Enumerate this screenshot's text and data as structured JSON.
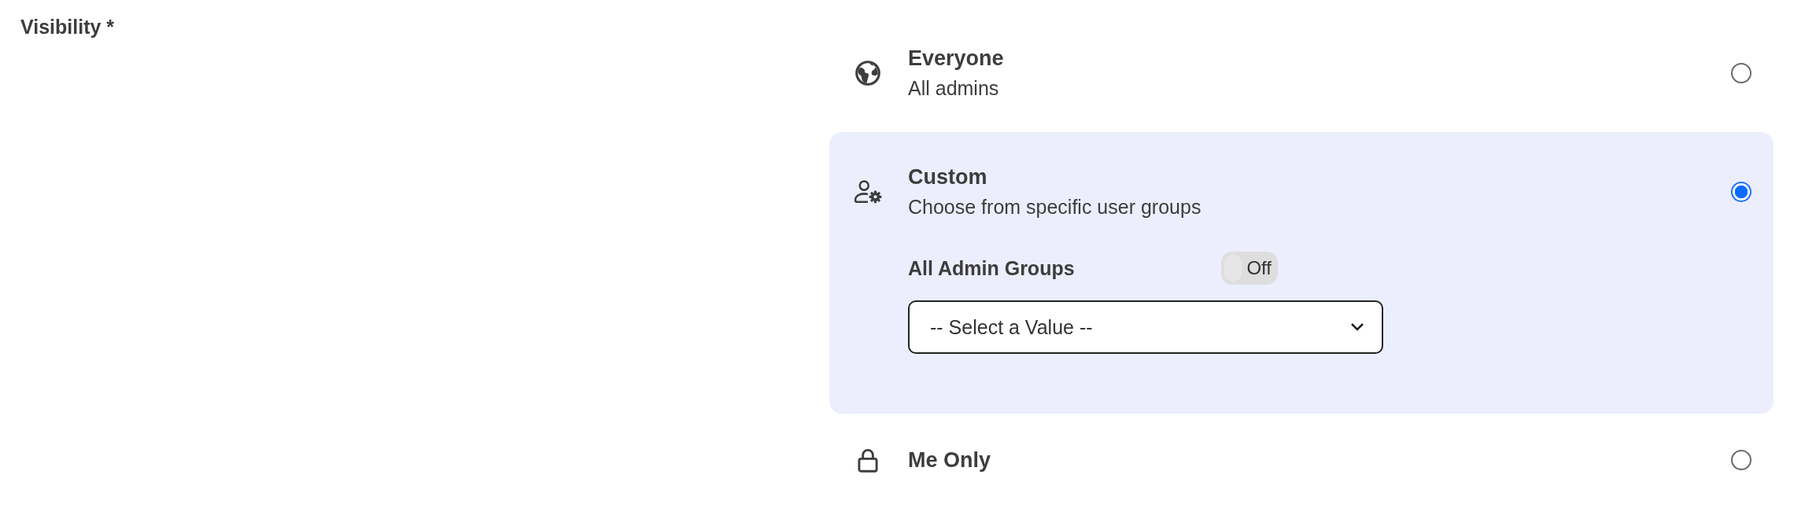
{
  "field_label": "Visibility *",
  "options": [
    {
      "kind": "globe",
      "title": "Everyone",
      "subtitle": "All admins",
      "selected": false
    },
    {
      "kind": "user-gear",
      "title": "Custom",
      "subtitle": "Choose from specific user groups",
      "selected": true,
      "toggle": {
        "label": "All Admin Groups",
        "on": false,
        "text": "Off"
      },
      "select": {
        "placeholder": "-- Select a Value --"
      }
    },
    {
      "kind": "lock",
      "title": "Me Only",
      "selected": false
    }
  ]
}
